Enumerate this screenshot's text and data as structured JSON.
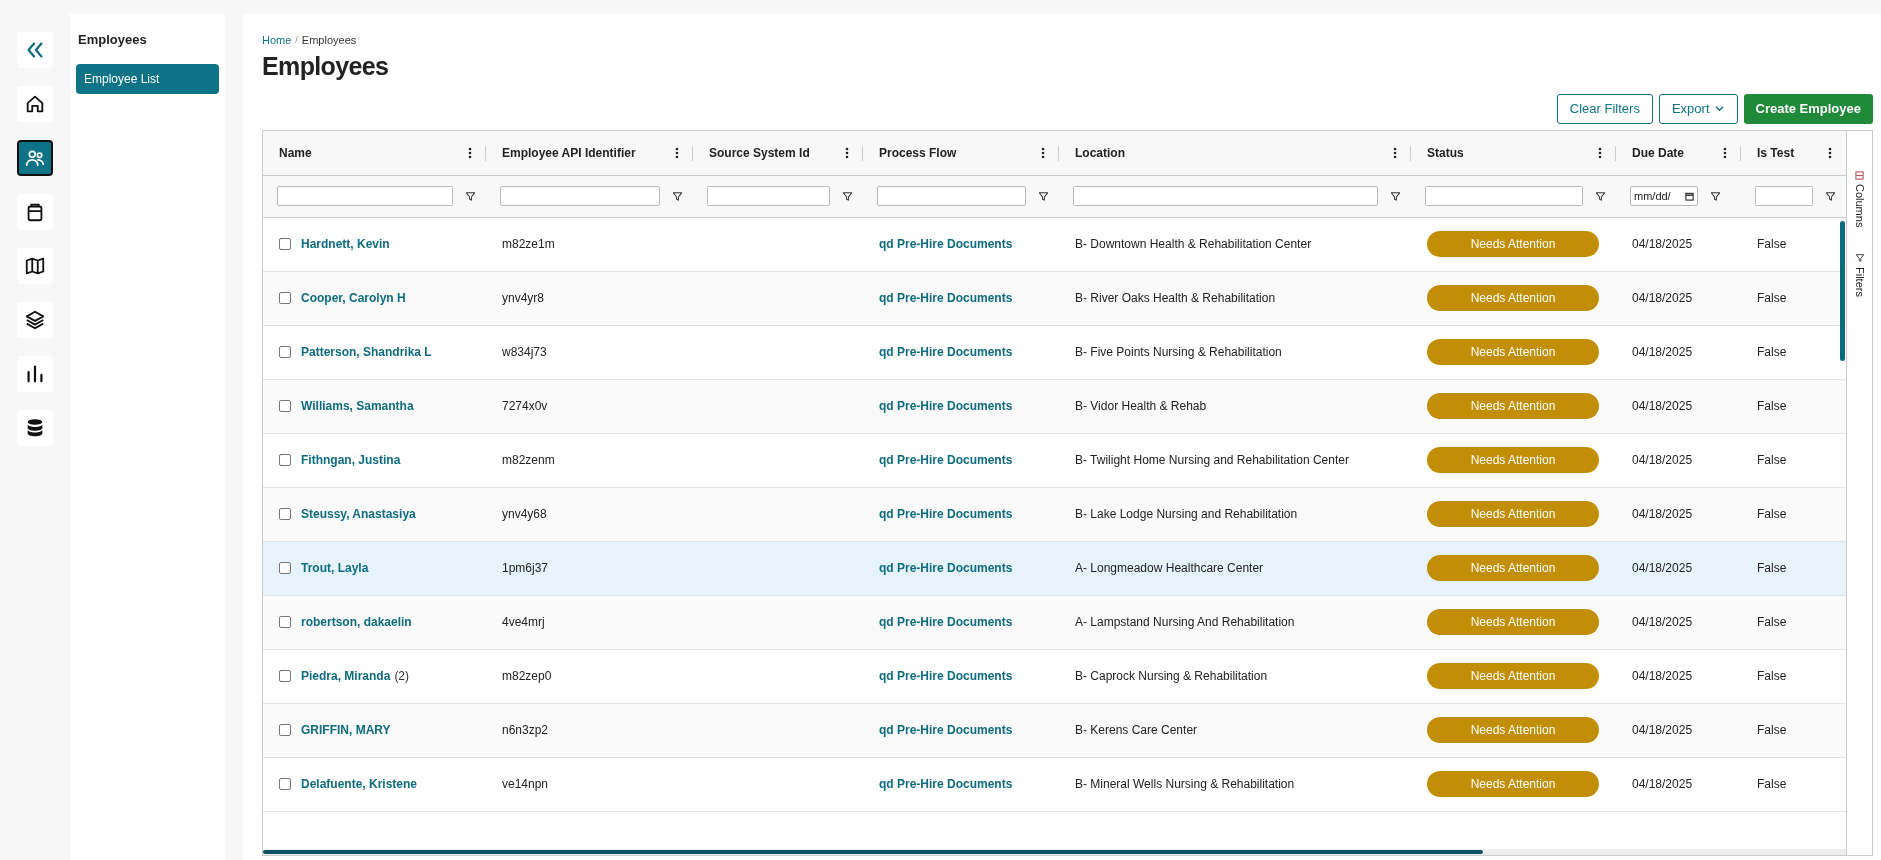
{
  "rail": [
    {
      "kind": "collapse",
      "selected": false
    },
    {
      "kind": "home",
      "selected": false
    },
    {
      "kind": "people",
      "selected": true
    },
    {
      "kind": "clipboard",
      "selected": false
    },
    {
      "kind": "map",
      "selected": false
    },
    {
      "kind": "layers",
      "selected": false
    },
    {
      "kind": "chart",
      "selected": false
    },
    {
      "kind": "database",
      "selected": false
    }
  ],
  "sidebar": {
    "title": "Employees",
    "items": [
      {
        "label": "Employee List",
        "selected": true
      }
    ]
  },
  "breadcrumb": {
    "separator": "/",
    "items": [
      "Home",
      "Employees"
    ]
  },
  "page_title": "Employees",
  "actions": [
    {
      "kind": "outline",
      "label": "Clear Filters"
    },
    {
      "kind": "dropdown",
      "label": "Export"
    },
    {
      "kind": "primary",
      "label": "Create Employee"
    }
  ],
  "table": {
    "columns": [
      {
        "label": "Name",
        "kind": "text"
      },
      {
        "label": "Employee API Identifier",
        "kind": "text"
      },
      {
        "label": "Source System Id",
        "kind": "text"
      },
      {
        "label": "Process Flow",
        "kind": "text"
      },
      {
        "label": "Location",
        "kind": "text"
      },
      {
        "label": "Status",
        "kind": "text"
      },
      {
        "label": "Due Date",
        "kind": "date",
        "placeholder": "mm/dd/"
      },
      {
        "label": "Is Test",
        "kind": "text"
      }
    ],
    "rows": [
      {
        "name": "Hardnett, Kevin",
        "api_id": "m82ze1m",
        "process_flow": "qd Pre-Hire Documents",
        "location": "B- Downtown Health & Rehabilitation Center",
        "status": "Needs Attention",
        "due_date": "04/18/2025",
        "is_test": "False",
        "checked": false,
        "highlighted": false
      },
      {
        "name": "Cooper, Carolyn H",
        "api_id": "ynv4yr8",
        "process_flow": "qd Pre-Hire Documents",
        "location": "B- River Oaks Health & Rehabilitation",
        "status": "Needs Attention",
        "due_date": "04/18/2025",
        "is_test": "False",
        "checked": false,
        "highlighted": false
      },
      {
        "name": "Patterson, Shandrika L",
        "api_id": "w834j73",
        "process_flow": "qd Pre-Hire Documents",
        "location": "B- Five Points Nursing & Rehabilitation",
        "status": "Needs Attention",
        "due_date": "04/18/2025",
        "is_test": "False",
        "checked": false,
        "highlighted": false
      },
      {
        "name": "Williams, Samantha",
        "api_id": "7274x0v",
        "process_flow": "qd Pre-Hire Documents",
        "location": "B- Vidor Health & Rehab",
        "status": "Needs Attention",
        "due_date": "04/18/2025",
        "is_test": "False",
        "checked": false,
        "highlighted": false
      },
      {
        "name": "Fithngan, Justina",
        "api_id": "m82zenm",
        "process_flow": "qd Pre-Hire Documents",
        "location": "B- Twilight Home Nursing and Rehabilitation Center",
        "status": "Needs Attention",
        "due_date": "04/18/2025",
        "is_test": "False",
        "checked": false,
        "highlighted": false
      },
      {
        "name": "Steussy, Anastasiya",
        "api_id": "ynv4y68",
        "process_flow": "qd Pre-Hire Documents",
        "location": "B- Lake Lodge Nursing and Rehabilitation",
        "status": "Needs Attention",
        "due_date": "04/18/2025",
        "is_test": "False",
        "checked": false,
        "highlighted": false
      },
      {
        "name": "Trout, Layla",
        "api_id": "1pm6j37",
        "process_flow": "qd Pre-Hire Documents",
        "location": "A- Longmeadow Healthcare Center",
        "status": "Needs Attention",
        "due_date": "04/18/2025",
        "is_test": "False",
        "checked": false,
        "highlighted": true
      },
      {
        "name": "robertson, dakaelin",
        "api_id": "4ve4mrj",
        "process_flow": "qd Pre-Hire Documents",
        "location": "A- Lampstand Nursing And Rehabilitation",
        "status": "Needs Attention",
        "due_date": "04/18/2025",
        "is_test": "False",
        "checked": false,
        "highlighted": false
      },
      {
        "name": "Piedra, Miranda",
        "count": "(2)",
        "api_id": "m82zep0",
        "process_flow": "qd Pre-Hire Documents",
        "location": "B- Caprock Nursing & Rehabilitation",
        "status": "Needs Attention",
        "due_date": "04/18/2025",
        "is_test": "False",
        "checked": false,
        "highlighted": false
      },
      {
        "name": "GRIFFIN, MARY",
        "api_id": "n6n3zp2",
        "process_flow": "qd Pre-Hire Documents",
        "location": "B- Kerens Care Center",
        "status": "Needs Attention",
        "due_date": "04/18/2025",
        "is_test": "False",
        "checked": false,
        "highlighted": false
      },
      {
        "name": "Delafuente, Kristene",
        "api_id": "ve14npn",
        "process_flow": "qd Pre-Hire Documents",
        "location": "B- Mineral Wells Nursing & Rehabilitation",
        "status": "Needs Attention",
        "due_date": "04/18/2025",
        "is_test": "False",
        "checked": false,
        "highlighted": false
      }
    ]
  },
  "side_tabs": [
    {
      "kind": "columns",
      "label": "Columns"
    },
    {
      "kind": "filters",
      "label": "Filters"
    }
  ]
}
